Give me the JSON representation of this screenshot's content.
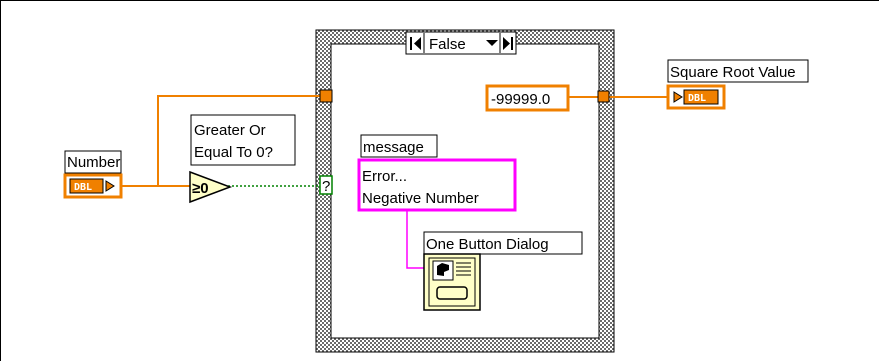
{
  "case_structure": {
    "selector_value": "False",
    "selector_prev_icon": "triangle-left-icon",
    "selector_dropdown_icon": "triangle-down-icon",
    "selector_next_icon": "triangle-right-icon",
    "selector_terminal_glyph": "?"
  },
  "controls": {
    "number_label": "Number",
    "number_type": "DBL"
  },
  "nodes": {
    "comparison_label_line1": "Greater Or",
    "comparison_label_line2": "Equal To 0?",
    "comparison_glyph": "≥0",
    "constant_value": "-99999.0",
    "message_label": "message",
    "message_line1": "Error...",
    "message_line2": "Negative Number",
    "dialog_label": "One Button Dialog"
  },
  "indicators": {
    "square_root_label": "Square Root Value",
    "square_root_type": "DBL"
  },
  "colors": {
    "numeric_wire": "#f08000",
    "boolean_wire": "#008000",
    "string_wire": "#ff00ff",
    "case_frame": "#808080"
  }
}
